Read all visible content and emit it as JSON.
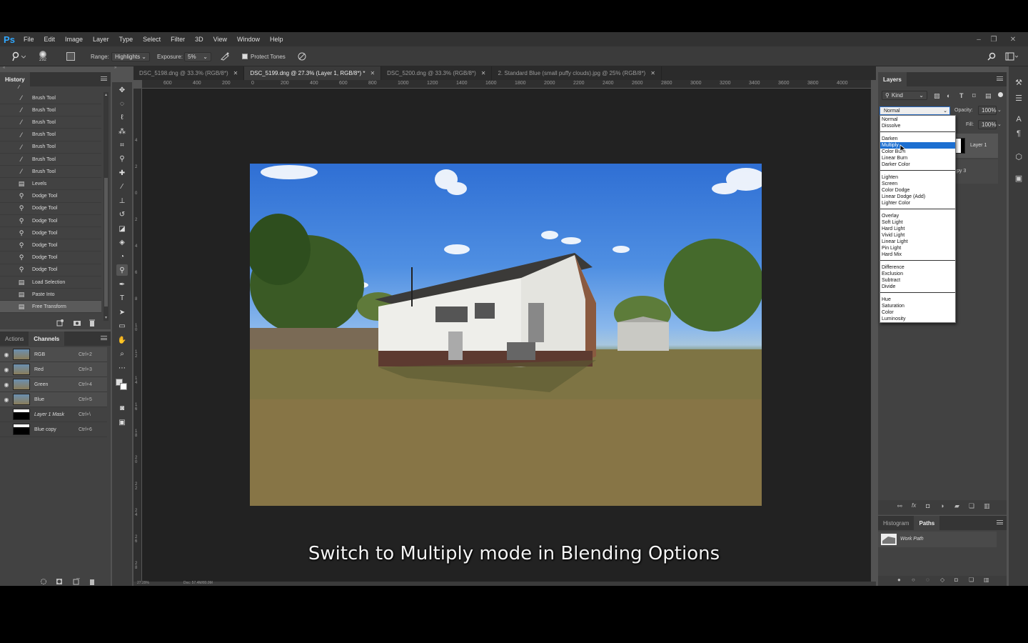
{
  "app": {
    "logo": "Ps"
  },
  "menu": [
    "File",
    "Edit",
    "Image",
    "Layer",
    "Type",
    "Select",
    "Filter",
    "3D",
    "View",
    "Window",
    "Help"
  ],
  "window_controls": {
    "minimize": "–",
    "restore": "❐",
    "close": "✕"
  },
  "options": {
    "brush_size": "292",
    "range_label": "Range:",
    "range_value": "Highlights",
    "exposure_label": "Exposure:",
    "exposure_value": "5%",
    "protect_tones_label": "Protect Tones"
  },
  "history": {
    "tab": "History",
    "items": [
      "Brush Tool",
      "Brush Tool",
      "Brush Tool",
      "Brush Tool",
      "Brush Tool",
      "Brush Tool",
      "Brush Tool",
      "Levels",
      "Dodge Tool",
      "Dodge Tool",
      "Dodge Tool",
      "Dodge Tool",
      "Dodge Tool",
      "Dodge Tool",
      "Dodge Tool",
      "Load Selection",
      "Paste Into",
      "Free Transform"
    ]
  },
  "channels": {
    "tabs": [
      "Actions",
      "Channels"
    ],
    "rows": [
      {
        "label": "RGB",
        "key": "Ctrl+2"
      },
      {
        "label": "Red",
        "key": "Ctrl+3"
      },
      {
        "label": "Green",
        "key": "Ctrl+4"
      },
      {
        "label": "Blue",
        "key": "Ctrl+5"
      },
      {
        "label": "Layer 1 Mask",
        "key": "Ctrl+\\"
      },
      {
        "label": "Blue copy",
        "key": "Ctrl+6"
      }
    ]
  },
  "doc_tabs": [
    {
      "title": "DSC_5198.dng @ 33.3% (RGB/8*)"
    },
    {
      "title": "DSC_5199.dng @ 27.3% (Layer 1, RGB/8*) *"
    },
    {
      "title": "DSC_5200.dng @ 33.3% (RGB/8*)"
    },
    {
      "title": "2. Standard Blue (small puffy clouds).jpg @ 25% (RGB/8*)"
    }
  ],
  "ruler_h": [
    "600",
    "400",
    "200",
    "0",
    "200",
    "400",
    "600",
    "800",
    "1000",
    "1200",
    "1400",
    "1600",
    "1800",
    "2000",
    "2200",
    "2400",
    "2600",
    "2800",
    "3000",
    "3200",
    "3400",
    "3600",
    "3800",
    "4000"
  ],
  "ruler_v": [
    "4",
    "2",
    "0",
    "2",
    "4",
    "6",
    "8",
    "1 0",
    "1 2",
    "1 4",
    "1 6",
    "1 8",
    "2 0",
    "2 2",
    "2 4",
    "2 6",
    "2 8",
    "3 0"
  ],
  "status": {
    "zoom": "27.29%",
    "doc": "Doc: 57.4M/80.9M"
  },
  "layers": {
    "tab": "Layers",
    "kind_label": "Kind",
    "blend_mode": "Normal",
    "opacity_label": "Opacity:",
    "opacity_value": "100%",
    "fill_label": "Fill:",
    "fill_value": "100%",
    "layer_name": "Layer 1",
    "layer2_name": "py 3"
  },
  "blend_groups": [
    [
      "Normal",
      "Dissolve"
    ],
    [
      "Darken",
      "Multiply",
      "Color Burn",
      "Linear Burn",
      "Darker Color"
    ],
    [
      "Lighten",
      "Screen",
      "Color Dodge",
      "Linear Dodge (Add)",
      "Lighter Color"
    ],
    [
      "Overlay",
      "Soft Light",
      "Hard Light",
      "Vivid Light",
      "Linear Light",
      "Pin Light",
      "Hard Mix"
    ],
    [
      "Difference",
      "Exclusion",
      "Subtract",
      "Divide"
    ],
    [
      "Hue",
      "Saturation",
      "Color",
      "Luminosity"
    ]
  ],
  "blend_highlighted": "Multiply",
  "paths": {
    "tabs": [
      "Histogram",
      "Paths"
    ],
    "item": "Work Path"
  },
  "caption": "Switch to Multiply mode in Blending Options"
}
